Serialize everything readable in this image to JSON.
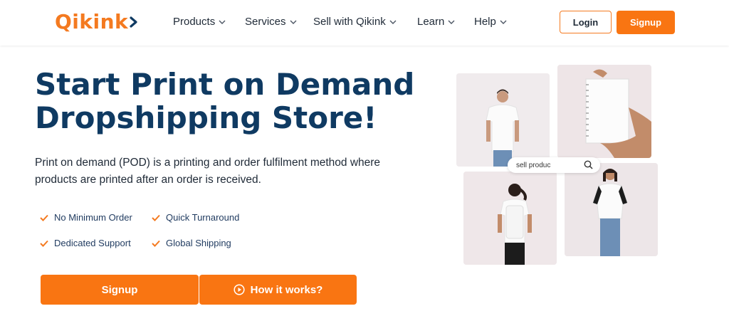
{
  "brand": {
    "name": "Qikink",
    "color": "#f47a20"
  },
  "nav": {
    "items": [
      {
        "label": "Products"
      },
      {
        "label": "Services"
      },
      {
        "label": "Sell with Qikink"
      },
      {
        "label": "Learn"
      },
      {
        "label": "Help"
      }
    ],
    "login_label": "Login",
    "signup_label": "Signup"
  },
  "hero": {
    "title_line1": "Start Print on Demand",
    "title_line2": "Dropshipping Store!",
    "description": "Print on demand (POD) is a printing and order fulfilment method where products are printed after an order is received.",
    "features": [
      "No Minimum Order",
      "Quick Turnaround",
      "Dedicated Support",
      "Global Shipping"
    ],
    "cta_signup": "Signup",
    "cta_how": "How it works?"
  },
  "collage": {
    "search_text": "sell produc"
  },
  "colors": {
    "accent": "#f97512",
    "heading": "#0f3a62"
  }
}
